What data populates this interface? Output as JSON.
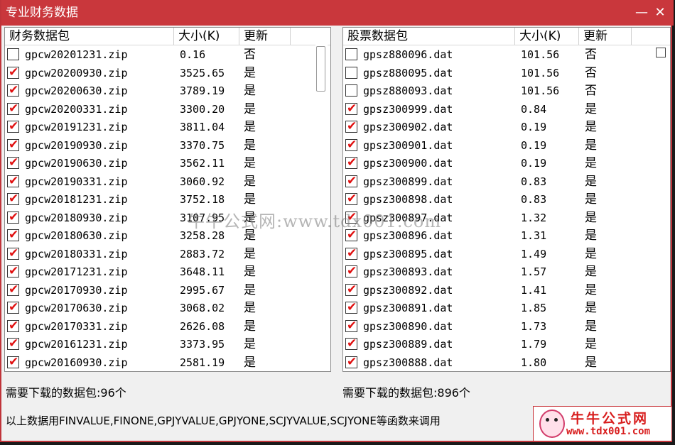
{
  "window": {
    "title": "专业财务数据"
  },
  "title_buttons": {
    "minimize": "—",
    "close": "✕"
  },
  "left_panel": {
    "columns": [
      "财务数据包",
      "大小(K)",
      "更新"
    ],
    "rows": [
      {
        "name": "gpcw20201231.zip",
        "size": "0.16",
        "update": "否",
        "checked": false
      },
      {
        "name": "gpcw20200930.zip",
        "size": "3525.65",
        "update": "是",
        "checked": true
      },
      {
        "name": "gpcw20200630.zip",
        "size": "3789.19",
        "update": "是",
        "checked": true
      },
      {
        "name": "gpcw20200331.zip",
        "size": "3300.20",
        "update": "是",
        "checked": true
      },
      {
        "name": "gpcw20191231.zip",
        "size": "3811.04",
        "update": "是",
        "checked": true
      },
      {
        "name": "gpcw20190930.zip",
        "size": "3370.75",
        "update": "是",
        "checked": true
      },
      {
        "name": "gpcw20190630.zip",
        "size": "3562.11",
        "update": "是",
        "checked": true
      },
      {
        "name": "gpcw20190331.zip",
        "size": "3060.92",
        "update": "是",
        "checked": true
      },
      {
        "name": "gpcw20181231.zip",
        "size": "3752.18",
        "update": "是",
        "checked": true
      },
      {
        "name": "gpcw20180930.zip",
        "size": "3107.95",
        "update": "是",
        "checked": true
      },
      {
        "name": "gpcw20180630.zip",
        "size": "3258.28",
        "update": "是",
        "checked": true
      },
      {
        "name": "gpcw20180331.zip",
        "size": "2883.72",
        "update": "是",
        "checked": true
      },
      {
        "name": "gpcw20171231.zip",
        "size": "3648.11",
        "update": "是",
        "checked": true
      },
      {
        "name": "gpcw20170930.zip",
        "size": "2995.67",
        "update": "是",
        "checked": true
      },
      {
        "name": "gpcw20170630.zip",
        "size": "3068.02",
        "update": "是",
        "checked": true
      },
      {
        "name": "gpcw20170331.zip",
        "size": "2626.08",
        "update": "是",
        "checked": true
      },
      {
        "name": "gpcw20161231.zip",
        "size": "3373.95",
        "update": "是",
        "checked": true
      },
      {
        "name": "gpcw20160930.zip",
        "size": "2581.19",
        "update": "是",
        "checked": true
      }
    ]
  },
  "right_panel": {
    "columns": [
      "股票数据包",
      "大小(K)",
      "更新"
    ],
    "rows": [
      {
        "name": "gpsz880096.dat",
        "size": "101.56",
        "update": "否",
        "checked": false
      },
      {
        "name": "gpsz880095.dat",
        "size": "101.56",
        "update": "否",
        "checked": false
      },
      {
        "name": "gpsz880093.dat",
        "size": "101.56",
        "update": "否",
        "checked": false
      },
      {
        "name": "gpsz300999.dat",
        "size": "0.84",
        "update": "是",
        "checked": true
      },
      {
        "name": "gpsz300902.dat",
        "size": "0.19",
        "update": "是",
        "checked": true
      },
      {
        "name": "gpsz300901.dat",
        "size": "0.19",
        "update": "是",
        "checked": true
      },
      {
        "name": "gpsz300900.dat",
        "size": "0.19",
        "update": "是",
        "checked": true
      },
      {
        "name": "gpsz300899.dat",
        "size": "0.83",
        "update": "是",
        "checked": true
      },
      {
        "name": "gpsz300898.dat",
        "size": "0.83",
        "update": "是",
        "checked": true
      },
      {
        "name": "gpsz300897.dat",
        "size": "1.32",
        "update": "是",
        "checked": true
      },
      {
        "name": "gpsz300896.dat",
        "size": "1.31",
        "update": "是",
        "checked": true
      },
      {
        "name": "gpsz300895.dat",
        "size": "1.49",
        "update": "是",
        "checked": true
      },
      {
        "name": "gpsz300893.dat",
        "size": "1.57",
        "update": "是",
        "checked": true
      },
      {
        "name": "gpsz300892.dat",
        "size": "1.41",
        "update": "是",
        "checked": true
      },
      {
        "name": "gpsz300891.dat",
        "size": "1.85",
        "update": "是",
        "checked": true
      },
      {
        "name": "gpsz300890.dat",
        "size": "1.73",
        "update": "是",
        "checked": true
      },
      {
        "name": "gpsz300889.dat",
        "size": "1.79",
        "update": "是",
        "checked": true
      },
      {
        "name": "gpsz300888.dat",
        "size": "1.80",
        "update": "是",
        "checked": true
      }
    ]
  },
  "status": {
    "left": "需要下载的数据包:96个",
    "right": "需要下载的数据包:896个"
  },
  "footer_note": "以上数据用FINVALUE,FINONE,GPJYVALUE,GPJYONE,SCJYVALUE,SCJYONE等函数来调用",
  "watermark": "牛牛公式网:www.tdx001.com",
  "logo": {
    "name": "牛牛公式网",
    "url": "www.tdx001.com"
  },
  "colors": {
    "title_bar": "#c9373c",
    "check_mark": "#e01010",
    "logo_text": "#d81e1e"
  }
}
